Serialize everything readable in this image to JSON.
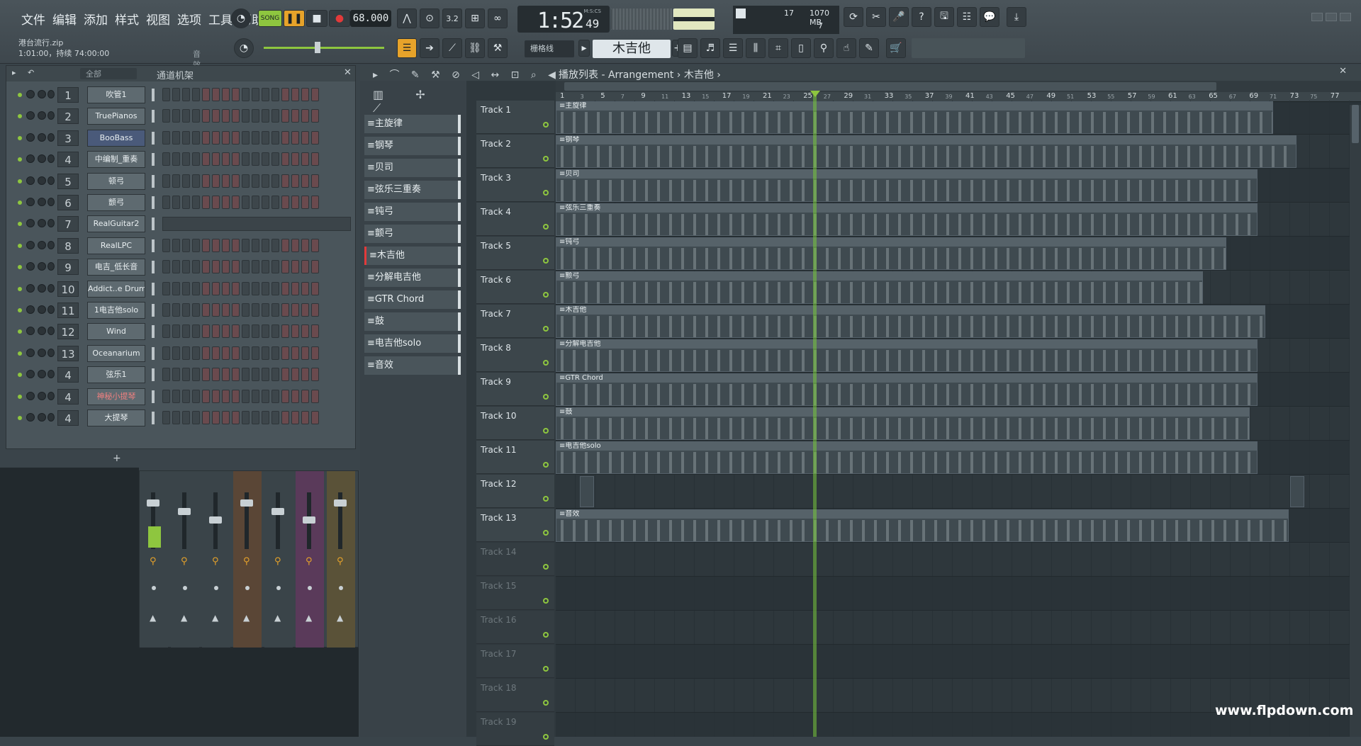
{
  "menu": [
    "文件",
    "编辑",
    "添加",
    "样式",
    "视图",
    "选项",
    "工具",
    "帮助"
  ],
  "project": {
    "name": "港台流行.zip",
    "info": "1:01:00，持续 74:00:00",
    "sfx": "音效"
  },
  "transport": {
    "mode": "SONG",
    "tempo": "68.000",
    "time": "1:52",
    "time_sub": "49",
    "time_label": "M:S:CS"
  },
  "cpu": {
    "val1": "17",
    "mem": "1070 MB",
    "poly": "7"
  },
  "toolbar2": {
    "grid": "栅格线",
    "pattern": "木吉他"
  },
  "rack": {
    "filter": "全部",
    "title": "通道机架",
    "add": "+",
    "channels": [
      {
        "num": "1",
        "name": "吹管1"
      },
      {
        "num": "2",
        "name": "TruePianos"
      },
      {
        "num": "3",
        "name": "BooBass"
      },
      {
        "num": "4",
        "name": "中编制_重奏"
      },
      {
        "num": "5",
        "name": "顿弓"
      },
      {
        "num": "6",
        "name": "颤弓"
      },
      {
        "num": "7",
        "name": "RealGuitar2"
      },
      {
        "num": "8",
        "name": "RealLPC"
      },
      {
        "num": "9",
        "name": "电吉_低长音"
      },
      {
        "num": "10",
        "name": "Addict..e Drums"
      },
      {
        "num": "11",
        "name": "1电吉他solo"
      },
      {
        "num": "12",
        "name": "Wind"
      },
      {
        "num": "13",
        "name": "Oceanarium"
      },
      {
        "num": "4",
        "name": "弦乐1"
      },
      {
        "num": "4",
        "name": "神秘小提琴"
      },
      {
        "num": "4",
        "name": "大提琴"
      }
    ]
  },
  "playlist": {
    "title": "播放列表 - Arrangement › 木吉他 ›",
    "patterns": [
      "主旋律",
      "钢琴",
      "贝司",
      "弦乐三重奏",
      "钝弓",
      "颤弓",
      "木吉他",
      "分解电吉他",
      "GTR Chord",
      "鼓",
      "电吉他solo",
      "音效"
    ],
    "tracks": [
      "Track 1",
      "Track 2",
      "Track 3",
      "Track 4",
      "Track 5",
      "Track 6",
      "Track 7",
      "Track 8",
      "Track 9",
      "Track 10",
      "Track 11",
      "Track 12",
      "Track 13",
      "Track 14",
      "Track 15",
      "Track 16",
      "Track 17",
      "Track 18",
      "Track 19"
    ],
    "clips": [
      {
        "track": 0,
        "label": "主旋律",
        "start": 0.0,
        "end": 0.92
      },
      {
        "track": 1,
        "label": "钢琴",
        "start": 0.0,
        "end": 0.95
      },
      {
        "track": 2,
        "label": "贝司",
        "start": 0.0,
        "end": 0.9
      },
      {
        "track": 3,
        "label": "弦乐三重奏",
        "start": 0.0,
        "end": 0.9
      },
      {
        "track": 4,
        "label": "钝弓",
        "start": 0.0,
        "end": 0.86
      },
      {
        "track": 5,
        "label": "颤弓",
        "start": 0.0,
        "end": 0.83
      },
      {
        "track": 6,
        "label": "木吉他",
        "start": 0.0,
        "end": 0.91
      },
      {
        "track": 7,
        "label": "分解电吉他",
        "start": 0.0,
        "end": 0.9
      },
      {
        "track": 8,
        "label": "GTR Chord",
        "start": 0.0,
        "end": 0.9
      },
      {
        "track": 9,
        "label": "鼓",
        "start": 0.0,
        "end": 0.89
      },
      {
        "track": 10,
        "label": "电吉他solo",
        "start": 0.0,
        "end": 0.9
      },
      {
        "track": 12,
        "label": "音效",
        "start": 0.0,
        "end": 0.94
      }
    ],
    "ruler": [
      "1",
      "3",
      "5",
      "7",
      "9",
      "11",
      "13",
      "15",
      "17",
      "19",
      "21",
      "23",
      "25",
      "27",
      "29",
      "31",
      "33",
      "35",
      "37",
      "39",
      "41",
      "43",
      "45",
      "47",
      "49",
      "51",
      "53",
      "55",
      "57",
      "59",
      "61",
      "63",
      "65",
      "67",
      "69",
      "71",
      "73",
      "75",
      "77"
    ]
  },
  "watermark": "www.flpdown.com"
}
